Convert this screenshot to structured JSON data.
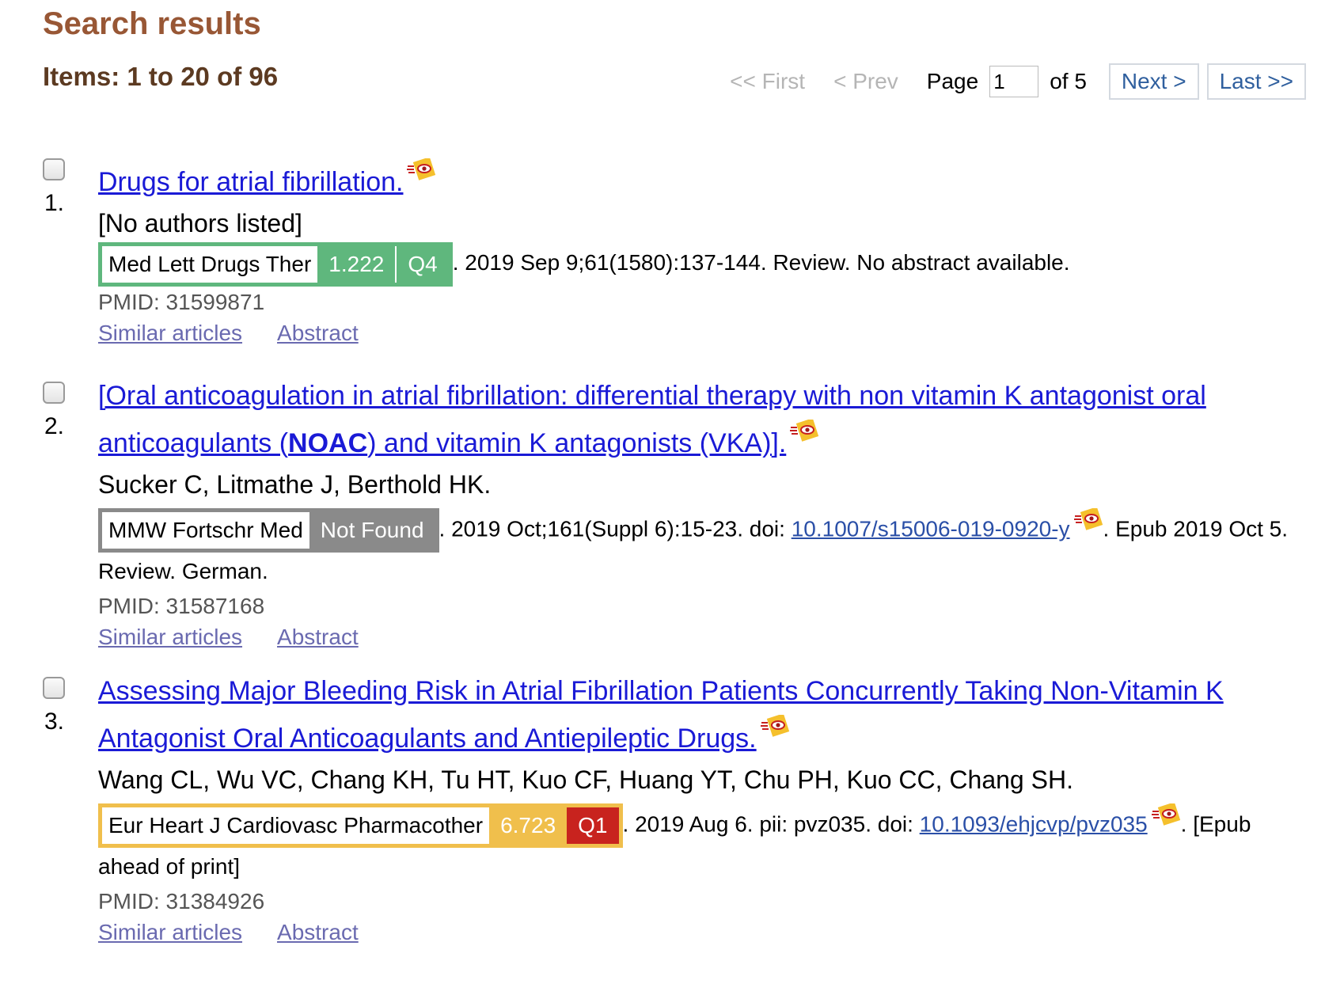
{
  "header": {
    "title": "Search results",
    "items_count": "Items: 1 to 20 of 96"
  },
  "pager": {
    "first": "<< First",
    "prev": "< Prev",
    "page_label": "Page",
    "page_value": "1",
    "of_label": "of 5",
    "next": "Next >",
    "last": "Last >>"
  },
  "results": [
    {
      "number": "1.",
      "title": "Drugs for atrial fibrillation.",
      "authors": "[No authors listed]",
      "journal": "Med Lett Drugs Ther",
      "impact_factor": "1.222",
      "quartile": "Q4",
      "badge_color": "#5fb77d",
      "details": ". 2019 Sep 9;61(1580):137-144. Review. No abstract available.",
      "pmid": "PMID: 31599871",
      "similar": "Similar articles",
      "abstract": "Abstract"
    },
    {
      "number": "2.",
      "title_pre": "[Oral anticoagulation in atrial fibrillation: differential therapy with non vitamin K antagonist oral anticoagulants (",
      "title_bold": "NOAC",
      "title_post": ") and vitamin K antagonists (VKA)].",
      "authors": "Sucker C, Litmathe J, Berthold HK.",
      "journal": "MMW Fortschr Med",
      "impact_factor": "Not Found",
      "badge_color": "#8a8a8a",
      "details_pre": ". 2019 Oct;161(Suppl 6):15-23. doi: ",
      "doi": "10.1007/s15006-019-0920-y",
      "details_post": ". Epub 2019 Oct 5. Review. German.",
      "pmid": "PMID: 31587168",
      "similar": "Similar articles",
      "abstract": "Abstract"
    },
    {
      "number": "3.",
      "title": "Assessing Major Bleeding Risk in Atrial Fibrillation Patients Concurrently Taking Non-Vitamin K Antagonist Oral Anticoagulants and Antiepileptic Drugs.",
      "authors": "Wang CL, Wu VC, Chang KH, Tu HT, Kuo CF, Huang YT, Chu PH, Kuo CC, Chang SH.",
      "journal": "Eur Heart J Cardiovasc Pharmacother",
      "impact_factor": "6.723",
      "quartile": "Q1",
      "badge_color": "#f0bf4c",
      "quartile_color": "#c8231e",
      "details_pre": ". 2019 Aug 6. pii: pvz035. doi: ",
      "doi": "10.1093/ehjcvp/pvz035",
      "details_post": ". [Epub ahead of print]",
      "pmid": "PMID: 31384926",
      "similar": "Similar articles",
      "abstract": "Abstract"
    }
  ]
}
